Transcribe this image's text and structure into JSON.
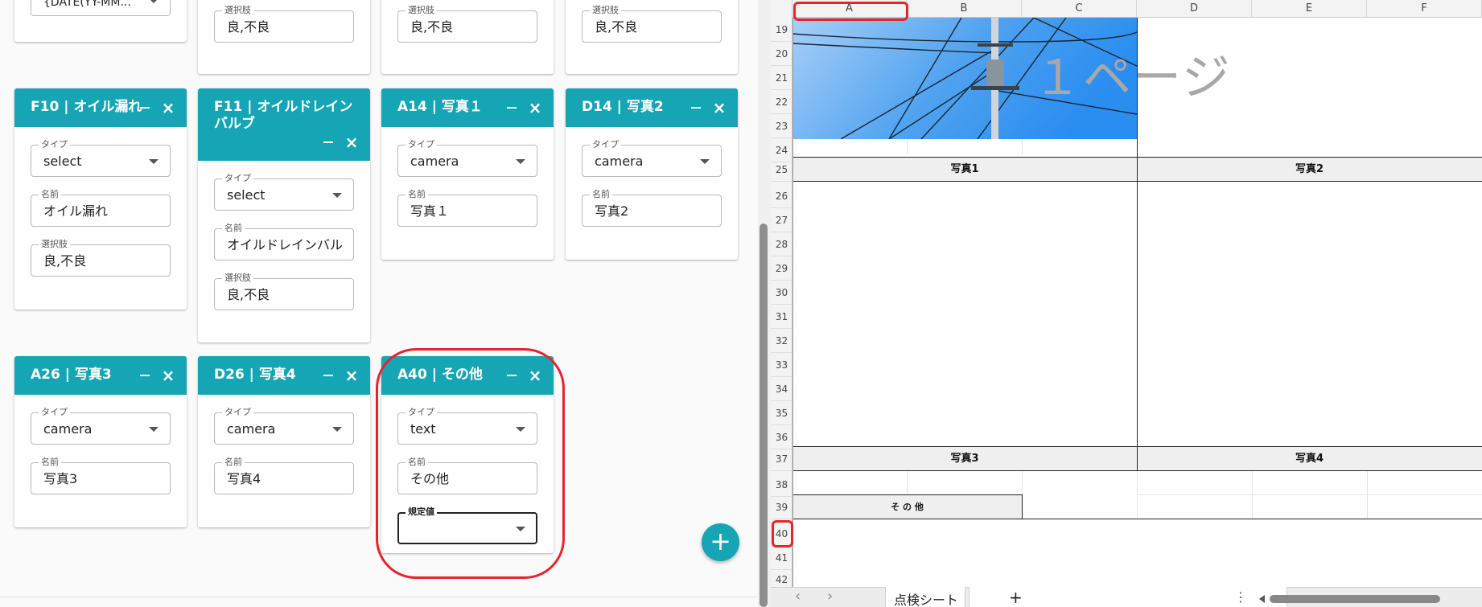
{
  "left_panel": {
    "row1_partial": {
      "col0": {
        "value": "{DATE(YY-MM..."
      },
      "col1": {
        "label": "選択肢",
        "value": "良,不良"
      },
      "col2": {
        "label": "選択肢",
        "value": "良,不良"
      },
      "col3": {
        "label": "選択肢",
        "value": "良,不良"
      }
    },
    "cards": [
      {
        "title": "F10 | オイル漏れ",
        "fields": [
          {
            "label": "タイプ",
            "value": "select",
            "dropdown": true
          },
          {
            "label": "名前",
            "value": "オイル漏れ"
          },
          {
            "label": "選択肢",
            "value": "良,不良"
          }
        ]
      },
      {
        "title": "F11 | オイルドレイン バルブ",
        "fields": [
          {
            "label": "タイプ",
            "value": "select",
            "dropdown": true
          },
          {
            "label": "名前",
            "value": "オイルドレインバル"
          },
          {
            "label": "選択肢",
            "value": "良,不良"
          }
        ]
      },
      {
        "title": "A14 | 写真１",
        "fields": [
          {
            "label": "タイプ",
            "value": "camera",
            "dropdown": true
          },
          {
            "label": "名前",
            "value": "写真１"
          }
        ]
      },
      {
        "title": "D14 | 写真2",
        "fields": [
          {
            "label": "タイプ",
            "value": "camera",
            "dropdown": true
          },
          {
            "label": "名前",
            "value": "写真2"
          }
        ]
      },
      {
        "title": "A26 | 写真3",
        "fields": [
          {
            "label": "タイプ",
            "value": "camera",
            "dropdown": true
          },
          {
            "label": "名前",
            "value": "写真3"
          }
        ]
      },
      {
        "title": "D26 | 写真4",
        "fields": [
          {
            "label": "タイプ",
            "value": "camera",
            "dropdown": true
          },
          {
            "label": "名前",
            "value": "写真4"
          }
        ]
      },
      {
        "title": "A40 | その他",
        "fields": [
          {
            "label": "タイプ",
            "value": "text",
            "dropdown": true
          },
          {
            "label": "名前",
            "value": "その他"
          },
          {
            "label": "規定値",
            "value": "",
            "dropdown": true,
            "focused": true
          }
        ]
      }
    ],
    "fab_label": "+"
  },
  "sheet": {
    "columns": [
      "A",
      "B",
      "C",
      "D",
      "E",
      "F"
    ],
    "rows": [
      "19",
      "20",
      "21",
      "22",
      "23",
      "24",
      "25",
      "26",
      "27",
      "28",
      "29",
      "30",
      "31",
      "32",
      "33",
      "34",
      "35",
      "36",
      "37",
      "38",
      "39",
      "40",
      "41",
      "42"
    ],
    "page_watermark": "１ページ",
    "cell_labels": {
      "photo1": "写真1",
      "photo2": "写真2",
      "photo3": "写真3",
      "photo4": "写真4",
      "other": "そ の 他"
    },
    "tabs": {
      "prev": "‹",
      "next": "›",
      "active": "点検シート",
      "add": "+",
      "more": "⋮"
    }
  },
  "colors": {
    "accent": "#16a5b5",
    "highlight": "#e8232e"
  }
}
